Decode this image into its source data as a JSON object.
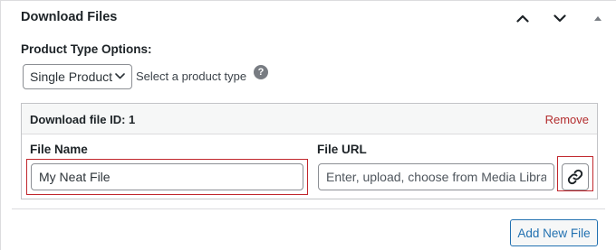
{
  "panel": {
    "title": "Download Files",
    "move_up_icon": "chevron-up-icon",
    "move_down_icon": "chevron-down-icon",
    "toggle_icon": "triangle-up-icon"
  },
  "product_type": {
    "label": "Product Type Options:",
    "selected": "Single Product",
    "hint": "Select a product type",
    "help_icon_glyph": "?"
  },
  "file": {
    "id_label": "Download file ID: 1",
    "remove_label": "Remove",
    "name_label": "File Name",
    "name_value": "My Neat File",
    "url_label": "File URL",
    "url_placeholder": "Enter, upload, choose from Media Library",
    "link_icon": "link-icon"
  },
  "actions": {
    "add_new_label": "Add New File"
  },
  "colors": {
    "accent": "#2271b1",
    "remove": "#b32d2e",
    "highlight": "#c1272d"
  }
}
